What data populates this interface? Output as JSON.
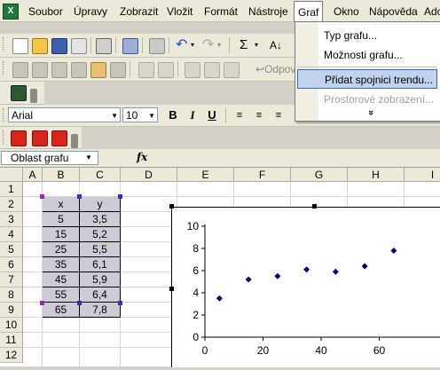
{
  "menubar": {
    "items": [
      "Soubor",
      "Úpravy",
      "Zobrazit",
      "Vložit",
      "Formát",
      "Nástroje",
      "Graf",
      "Okno",
      "Nápověda",
      "Adob"
    ]
  },
  "graf_menu": {
    "items": [
      {
        "label": "Typ grafu..."
      },
      {
        "label": "Možnosti grafu..."
      },
      {
        "label": "Přidat spojnici trendu..."
      },
      {
        "label": "Prostorové zobrazení..."
      }
    ],
    "more": "»"
  },
  "toolbar2": {
    "odpov_label": "Odpov"
  },
  "format_toolbar": {
    "font": "Arial",
    "size": "10",
    "bold": "B",
    "italic": "I",
    "underline": "U"
  },
  "formula_bar": {
    "name_box": "Oblast grafu",
    "fx": "fx"
  },
  "columns": [
    "A",
    "B",
    "C",
    "D",
    "E",
    "F",
    "G",
    "H",
    "I"
  ],
  "rows": [
    "1",
    "2",
    "3",
    "4",
    "5",
    "6",
    "7",
    "8",
    "9",
    "10",
    "11",
    "12"
  ],
  "table": {
    "headers": [
      "x",
      "y"
    ],
    "rows": [
      [
        "5",
        "3,5"
      ],
      [
        "15",
        "5,2"
      ],
      [
        "25",
        "5,5"
      ],
      [
        "35",
        "6,1"
      ],
      [
        "45",
        "5,9"
      ],
      [
        "55",
        "6,4"
      ],
      [
        "65",
        "7,8"
      ]
    ]
  },
  "chart_data": {
    "type": "scatter",
    "series": [
      {
        "x": [
          5,
          15,
          25,
          35,
          45,
          55,
          65
        ],
        "y": [
          3.5,
          5.2,
          5.5,
          6.1,
          5.9,
          6.4,
          7.8
        ],
        "color": "#00007f"
      }
    ],
    "y_ticks": [
      "0",
      "2",
      "4",
      "6",
      "8",
      "10"
    ],
    "x_ticks": [
      "0",
      "20",
      "40",
      "60"
    ],
    "xlim": [
      0,
      80
    ],
    "ylim": [
      0,
      10
    ],
    "grid": false
  }
}
